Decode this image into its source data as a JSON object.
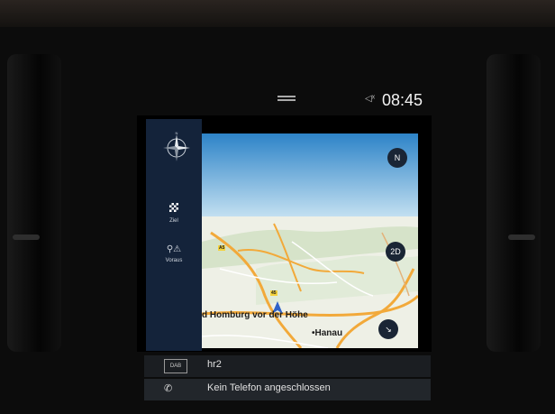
{
  "status_bar": {
    "time": "08:45"
  },
  "side_panel": {
    "items": [
      {
        "label": "Ziel",
        "icon": "checkered-flag-icon"
      },
      {
        "label": "Voraus",
        "icon": "pin-warning-icon"
      }
    ]
  },
  "map": {
    "place_labels": [
      "d Homburg vor der Höhe",
      "•Hanau"
    ],
    "road_badges": [
      "45",
      "A5"
    ],
    "view_mode_button": "2D"
  },
  "info_rows": {
    "radio_source": "DAB",
    "radio_station": "hr2",
    "phone_status": "Kein Telefon angeschlossen"
  },
  "colors": {
    "side_panel": "#14233a",
    "sky_top": "#2d83c8",
    "land": "#eef0e6",
    "road": "#f2a93a",
    "vehicle_arrow": "#2f63c8"
  }
}
